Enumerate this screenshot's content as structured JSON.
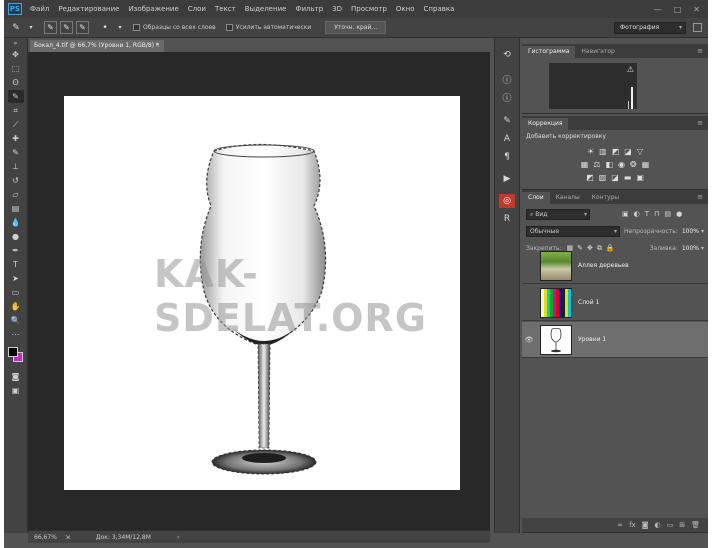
{
  "app": {
    "logo": "PS",
    "menu": [
      "Файл",
      "Редактирование",
      "Изображение",
      "Слои",
      "Текст",
      "Выделение",
      "Фильтр",
      "3D",
      "Просмотр",
      "Окно",
      "Справка"
    ],
    "window_controls": [
      "—",
      "□",
      "✕"
    ]
  },
  "options": {
    "sample_all_layers": "Образцы со всех слоев",
    "auto_enhance": "Усилить автоматически",
    "refine_edge": "Уточн. край...",
    "workspace": "Фотография"
  },
  "document": {
    "tab_title": "Бокал_4.tif @ 66,7% (Уровни 1, RGB/8) *",
    "watermark": "KAK-SDELAT.ORG",
    "zoom": "66,67%",
    "doc_size": "Док: 3,34M/12,8M"
  },
  "panels": {
    "histogram": {
      "tabs": [
        "Гистограмма",
        "Навигатор"
      ]
    },
    "corrections": {
      "tab": "Коррекция",
      "title": "Добавить корректировку"
    },
    "layers": {
      "tabs": [
        "Слои",
        "Каналы",
        "Контуры"
      ],
      "filter_kind": "Вид",
      "blend_mode": "Обычные",
      "opacity_label": "Непрозрачность:",
      "opacity_value": "100%",
      "lock_label": "Закрепить:",
      "fill_label": "Заливка:",
      "fill_value": "100%",
      "items": [
        {
          "name": "Аллея деревьев",
          "visible": false
        },
        {
          "name": "Слой 1",
          "visible": false
        },
        {
          "name": "Уровни 1",
          "visible": true,
          "selected": true
        }
      ]
    }
  },
  "colors": {
    "foreground": "#000000",
    "background": "#c030c0"
  }
}
